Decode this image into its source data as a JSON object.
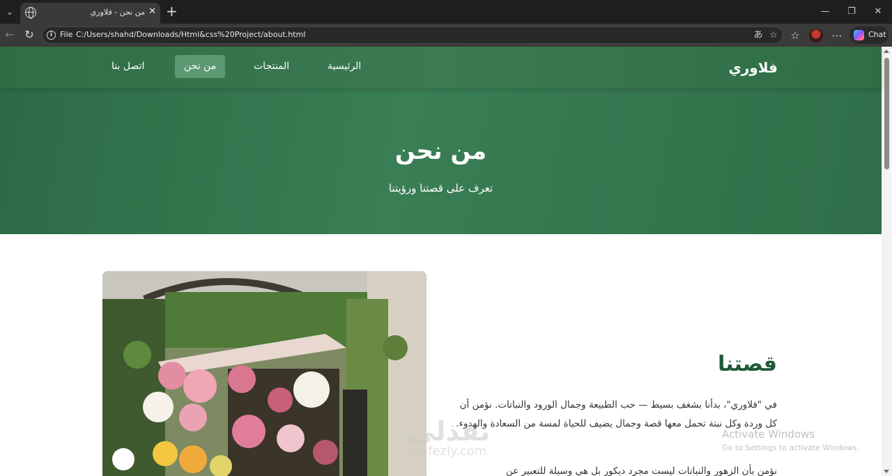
{
  "browser": {
    "tab_title": "من نحن - فلاوري",
    "tab_close": "✕",
    "new_tab": "+",
    "file_label": "File",
    "url": "C:/Users/shahd/Downloads/Html&css%20Project/about.html",
    "chat_label": "Chat",
    "window_controls": [
      "—",
      "❐",
      "✕"
    ]
  },
  "site": {
    "brand": "فلاوري",
    "nav": [
      {
        "label": "الرئيسية",
        "active": false
      },
      {
        "label": "المنتجات",
        "active": false
      },
      {
        "label": "من نحن",
        "active": true
      },
      {
        "label": "اتصل بنا",
        "active": false
      }
    ],
    "hero": {
      "title": "من نحن",
      "subtitle": "تعرف على قصتنا ورؤيتنا"
    },
    "story": {
      "title": "قصتنا",
      "paragraph1": "في \"فلاوري\"، بدأنا بشغف بسيط — حب الطبيعة وجمال الورود والنباتات. نؤمن أن كل وردة وكل نبتة تحمل معها قصة وجمال يضيف للحياة لمسة من السعادة والهدوء.",
      "paragraph2": "نؤمن بأن الزهور والنباتات ليست مجرد ديكور بل هي وسيلة للتعبير عن"
    }
  },
  "overlays": {
    "activate_title": "Activate Windows",
    "activate_sub": "Go to Settings to activate Windows.",
    "logo_text": "نفذلي",
    "logo_domain": "nafezly.com"
  },
  "colors": {
    "header": "#2f6d45",
    "hero": "#3a7e55",
    "active_nav": "#5b9a72",
    "story_title": "#1f5a38"
  }
}
